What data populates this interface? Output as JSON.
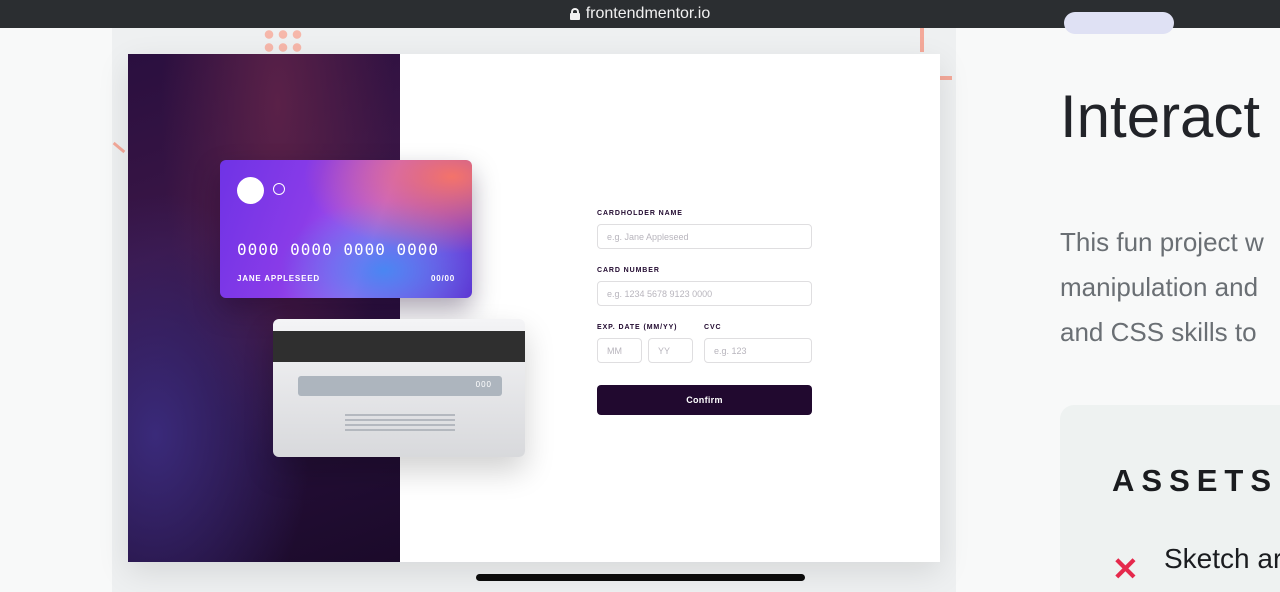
{
  "browser": {
    "url": "frontendmentor.io"
  },
  "preview": {
    "card_front": {
      "number": "0000 0000 0000 0000",
      "holder": "JANE APPLESEED",
      "expiry": "00/00"
    },
    "card_back": {
      "cvc": "000"
    },
    "form": {
      "name_label": "CARDHOLDER NAME",
      "name_placeholder": "e.g. Jane Appleseed",
      "number_label": "CARD NUMBER",
      "number_placeholder": "e.g. 1234 5678 9123 0000",
      "exp_label": "EXP. DATE (MM/YY)",
      "mm_placeholder": "MM",
      "yy_placeholder": "YY",
      "cvc_label": "CVC",
      "cvc_placeholder": "e.g. 123",
      "confirm_label": "Confirm"
    }
  },
  "page": {
    "title": "Interact",
    "description": [
      "This fun project w",
      "manipulation and",
      "and CSS skills to"
    ],
    "assets_title": "ASSETS",
    "asset_item": "Sketch ar"
  },
  "colors": {
    "dark_violet": "#21092f",
    "error_red": "#e5294c",
    "browser_bar": "#2b2e31"
  }
}
